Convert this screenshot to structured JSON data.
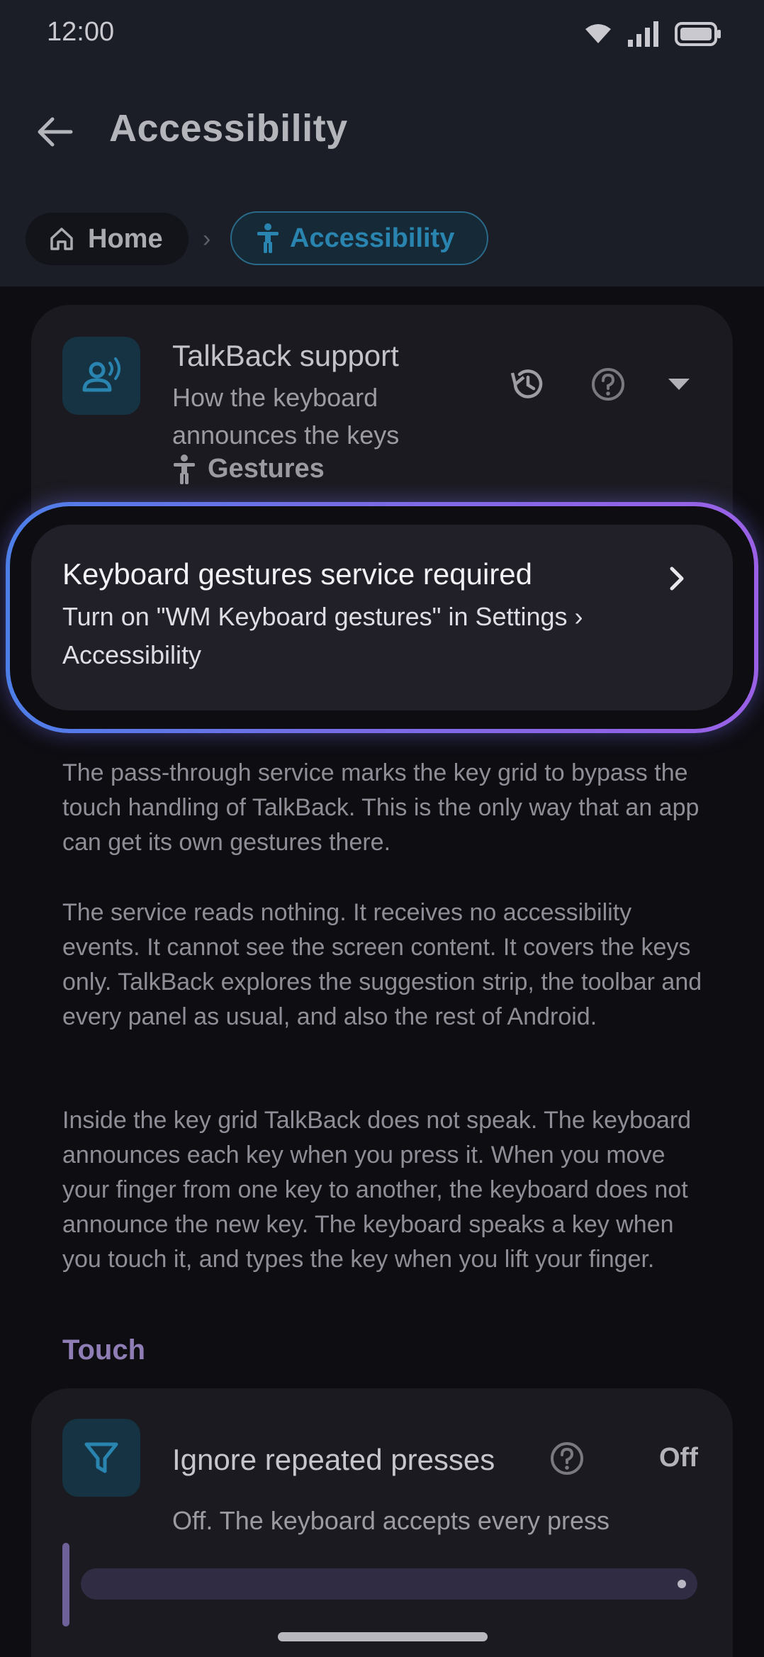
{
  "status_bar": {
    "time": "12:00",
    "icons": [
      "wifi-icon",
      "cellular-signal-icon",
      "battery-icon"
    ]
  },
  "app_bar": {
    "title": "Accessibility",
    "back_icon": "arrow-back-icon"
  },
  "breadcrumb": [
    {
      "label": "Home",
      "icon": "home-icon"
    },
    {
      "label": "Accessibility",
      "icon": "accessibility-icon",
      "active": true
    }
  ],
  "talkback_card": {
    "title": "TalkBack support",
    "subtitle": "How the keyboard announces the keys",
    "link_label": "Gestures",
    "icons": [
      "record-voice-icon",
      "history-icon",
      "help-icon",
      "dropdown-arrow-icon"
    ]
  },
  "callout": {
    "title": "Keyboard gestures service required",
    "body": "Turn on \"WM Keyboard gestures\" in Settings › Accessibility"
  },
  "paragraphs": [
    "The pass-through service marks the key grid to bypass the touch handling of TalkBack. This is the only way that an app can get its own gestures there.",
    "The service reads nothing. It receives no accessibility events. It cannot see the screen content. It covers the keys only. TalkBack explores the suggestion strip, the toolbar and every panel as usual, and also the rest of Android.",
    "Inside the key grid TalkBack does not speak. The keyboard announces each key when you press it. When you move your finger from one key to another, the keyboard does not announce the new key. The keyboard speaks a key when you touch it, and types the key when you lift your finger."
  ],
  "touch_section": {
    "heading": "Touch",
    "item": {
      "title": "Ignore repeated presses",
      "value": "Off",
      "subtitle": "Off. The keyboard accepts every press",
      "slider_level": 0
    }
  },
  "colors": {
    "accent_blue": "#2a84b0",
    "accent_purple": "#8f7eb6",
    "glow_start": "#4d7ee8",
    "glow_end": "#9a61e6"
  }
}
